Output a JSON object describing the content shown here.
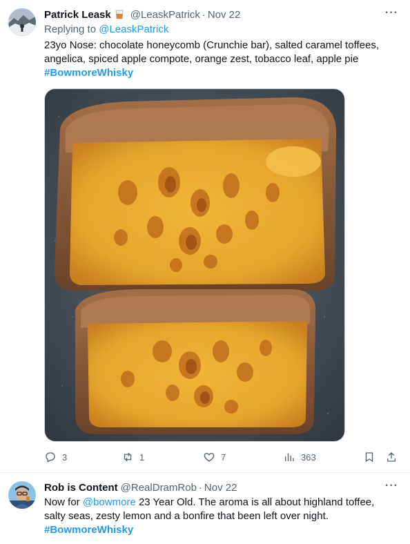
{
  "tweets": [
    {
      "author_name": "Patrick Leask",
      "author_emoji": "whisky-glass-icon",
      "handle": "@LeaskPatrick",
      "separator": "·",
      "date": "Nov 22",
      "more_icon": "···",
      "replying_prefix": "Replying to",
      "replying_handle": "@LeaskPatrick",
      "text_lines": [
        "23yo Nose: chocolate honeycomb (Crunchie bar), salted caramel toffees,",
        "angelica, spiced apple compote, orange zest, tobacco leaf, apple pie"
      ],
      "hashtag": "#BowmoreWhisky",
      "image_alt": "Crunchie honeycomb chocolate bar cut in half",
      "actions": {
        "replies": "3",
        "retweets": "1",
        "likes": "7",
        "views": "363"
      }
    },
    {
      "author_name": "Rob is Content",
      "handle": "@RealDramRob",
      "separator": "·",
      "date": "Nov 22",
      "more_icon": "···",
      "text_line1_prefix": "Now for ",
      "text_line1_mention": "@bowmore",
      "text_line1_suffix": " 23 Year Old. The aroma is all about highland toffee,",
      "text_line2": "salty seas, zesty lemon and a bonfire that been left over night.",
      "hashtag": "#BowmoreWhisky"
    }
  ],
  "colors": {
    "link": "#1d9bf0",
    "secondary": "#536471",
    "primary": "#0f1419"
  }
}
